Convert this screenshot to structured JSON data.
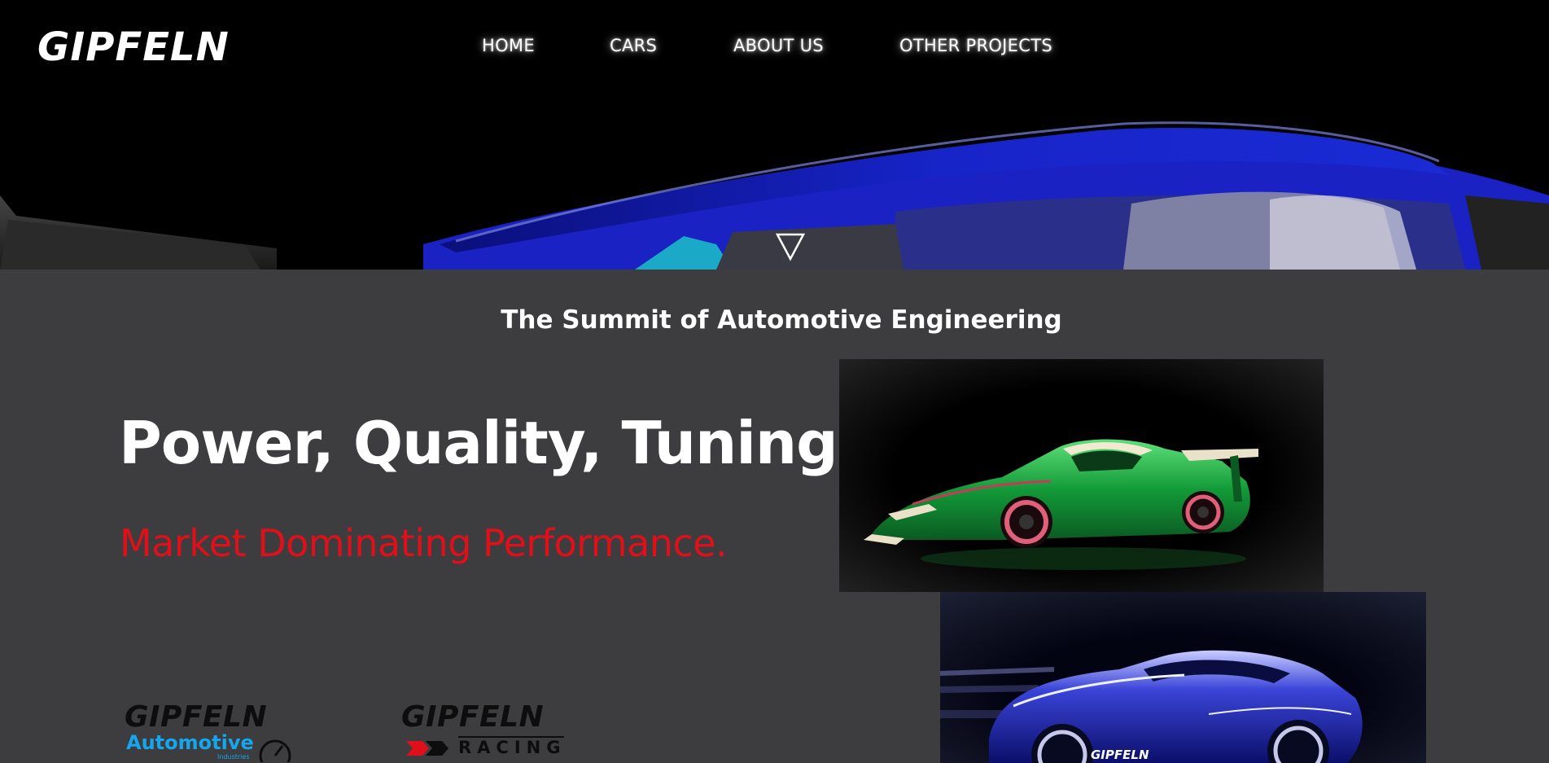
{
  "brand": {
    "logo_text": "GIPFELN"
  },
  "nav": {
    "items": [
      {
        "label": "HOME"
      },
      {
        "label": "CARS"
      },
      {
        "label": "ABOUT US"
      },
      {
        "label": "OTHER PROJECTS"
      }
    ]
  },
  "hero": {
    "scroll_icon": "triangle-down-icon"
  },
  "main": {
    "tagline": "The Summit of Automotive Engineering",
    "headline": "Power, Quality, Tuning.",
    "subheadline": "Market Dominating Performance."
  },
  "sub_brands": [
    {
      "name": "GIPFELN",
      "line": "Automotive",
      "small": "Industries"
    },
    {
      "name": "GIPFELN",
      "line": "RACING"
    }
  ],
  "blue_car": {
    "badge": "GIPFELN"
  },
  "colors": {
    "background": "#3d3c3e",
    "hero_bg": "#000000",
    "accent_red": "#e0101a",
    "accent_blue": "#15a6ee",
    "car_blue": "#1a22c4"
  }
}
